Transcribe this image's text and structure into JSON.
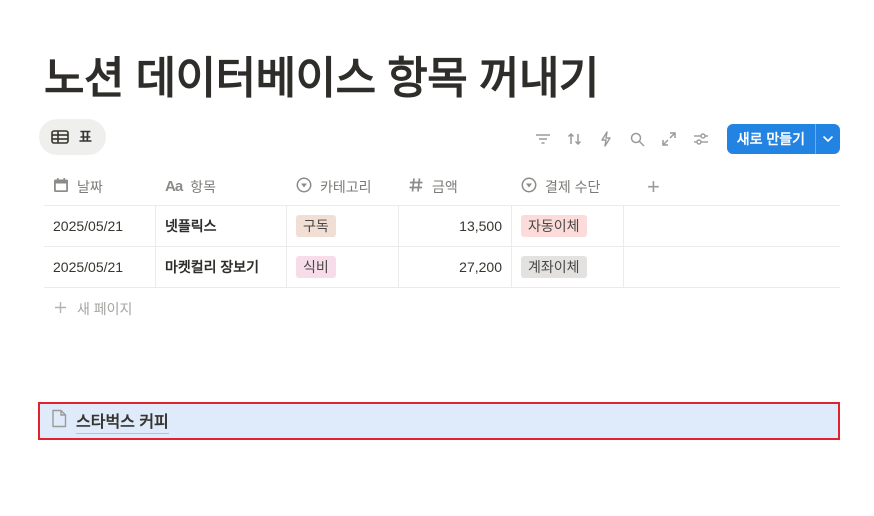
{
  "page": {
    "title": "노션 데이터베이스 항목 꺼내기"
  },
  "view": {
    "icon": "table-icon",
    "label": "표"
  },
  "toolbar": {
    "icons": [
      "filter-icon",
      "sort-icon",
      "lightning-icon",
      "search-icon",
      "expand-icon",
      "settings-sliders-icon"
    ],
    "new_button_label": "새로 만들기",
    "new_button_color": "#2383e2"
  },
  "table": {
    "columns": [
      {
        "icon": "calendar-icon",
        "label": "날짜"
      },
      {
        "icon": "text-aa-icon",
        "label": "항목"
      },
      {
        "icon": "select-icon",
        "label": "카테고리"
      },
      {
        "icon": "hash-icon",
        "label": "금액"
      },
      {
        "icon": "select-icon",
        "label": "결제 수단"
      }
    ],
    "rows": [
      {
        "date": "2025/05/21",
        "item": "넷플릭스",
        "category": "구독",
        "category_color": "#f1ded4",
        "amount": "13,500",
        "payment": "자동이체",
        "payment_color": "#fbdcdb"
      },
      {
        "date": "2025/05/21",
        "item": "마켓컬리 장보기",
        "category": "식비",
        "category_color": "#f7dcea",
        "amount": "27,200",
        "payment": "계좌이체",
        "payment_color": "#e3e2e0"
      }
    ],
    "new_page_label": "새 페이지"
  },
  "dragged_item": {
    "icon": "page-icon",
    "label": "스타벅스 커피",
    "highlight_color": "#e0232f"
  }
}
